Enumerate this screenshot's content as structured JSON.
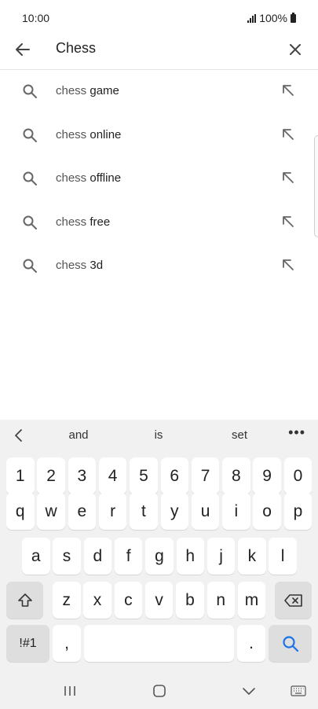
{
  "status_bar": {
    "time": "10:00",
    "battery": "100%"
  },
  "search": {
    "query": "Chess"
  },
  "suggestions": [
    {
      "prefix": "chess ",
      "completion": "game"
    },
    {
      "prefix": "chess ",
      "completion": "online"
    },
    {
      "prefix": "chess ",
      "completion": "offline"
    },
    {
      "prefix": "chess ",
      "completion": "free"
    },
    {
      "prefix": "chess ",
      "completion": "3d"
    }
  ],
  "keyboard": {
    "predictions": [
      "and",
      "is",
      "set"
    ],
    "more_label": "•••",
    "row_numbers": [
      "1",
      "2",
      "3",
      "4",
      "5",
      "6",
      "7",
      "8",
      "9",
      "0"
    ],
    "row_q": [
      "q",
      "w",
      "e",
      "r",
      "t",
      "y",
      "u",
      "i",
      "o",
      "p"
    ],
    "row_a": [
      "a",
      "s",
      "d",
      "f",
      "g",
      "h",
      "j",
      "k",
      "l"
    ],
    "row_z": [
      "z",
      "x",
      "c",
      "v",
      "b",
      "n",
      "m"
    ],
    "symbols_label": "!#1",
    "comma_label": ",",
    "period_label": ".",
    "accent_color": "#1a73e8"
  },
  "icons": {
    "back": "arrow-left-icon",
    "clear": "close-icon",
    "suggestion": "search-icon",
    "fill": "arrow-up-left-icon",
    "shift": "shift-icon",
    "backspace": "backspace-icon",
    "enter": "search-icon",
    "recents": "recents-icon",
    "home": "home-icon",
    "hide_keyboard": "chevron-down-icon",
    "keyboard": "keyboard-icon"
  }
}
